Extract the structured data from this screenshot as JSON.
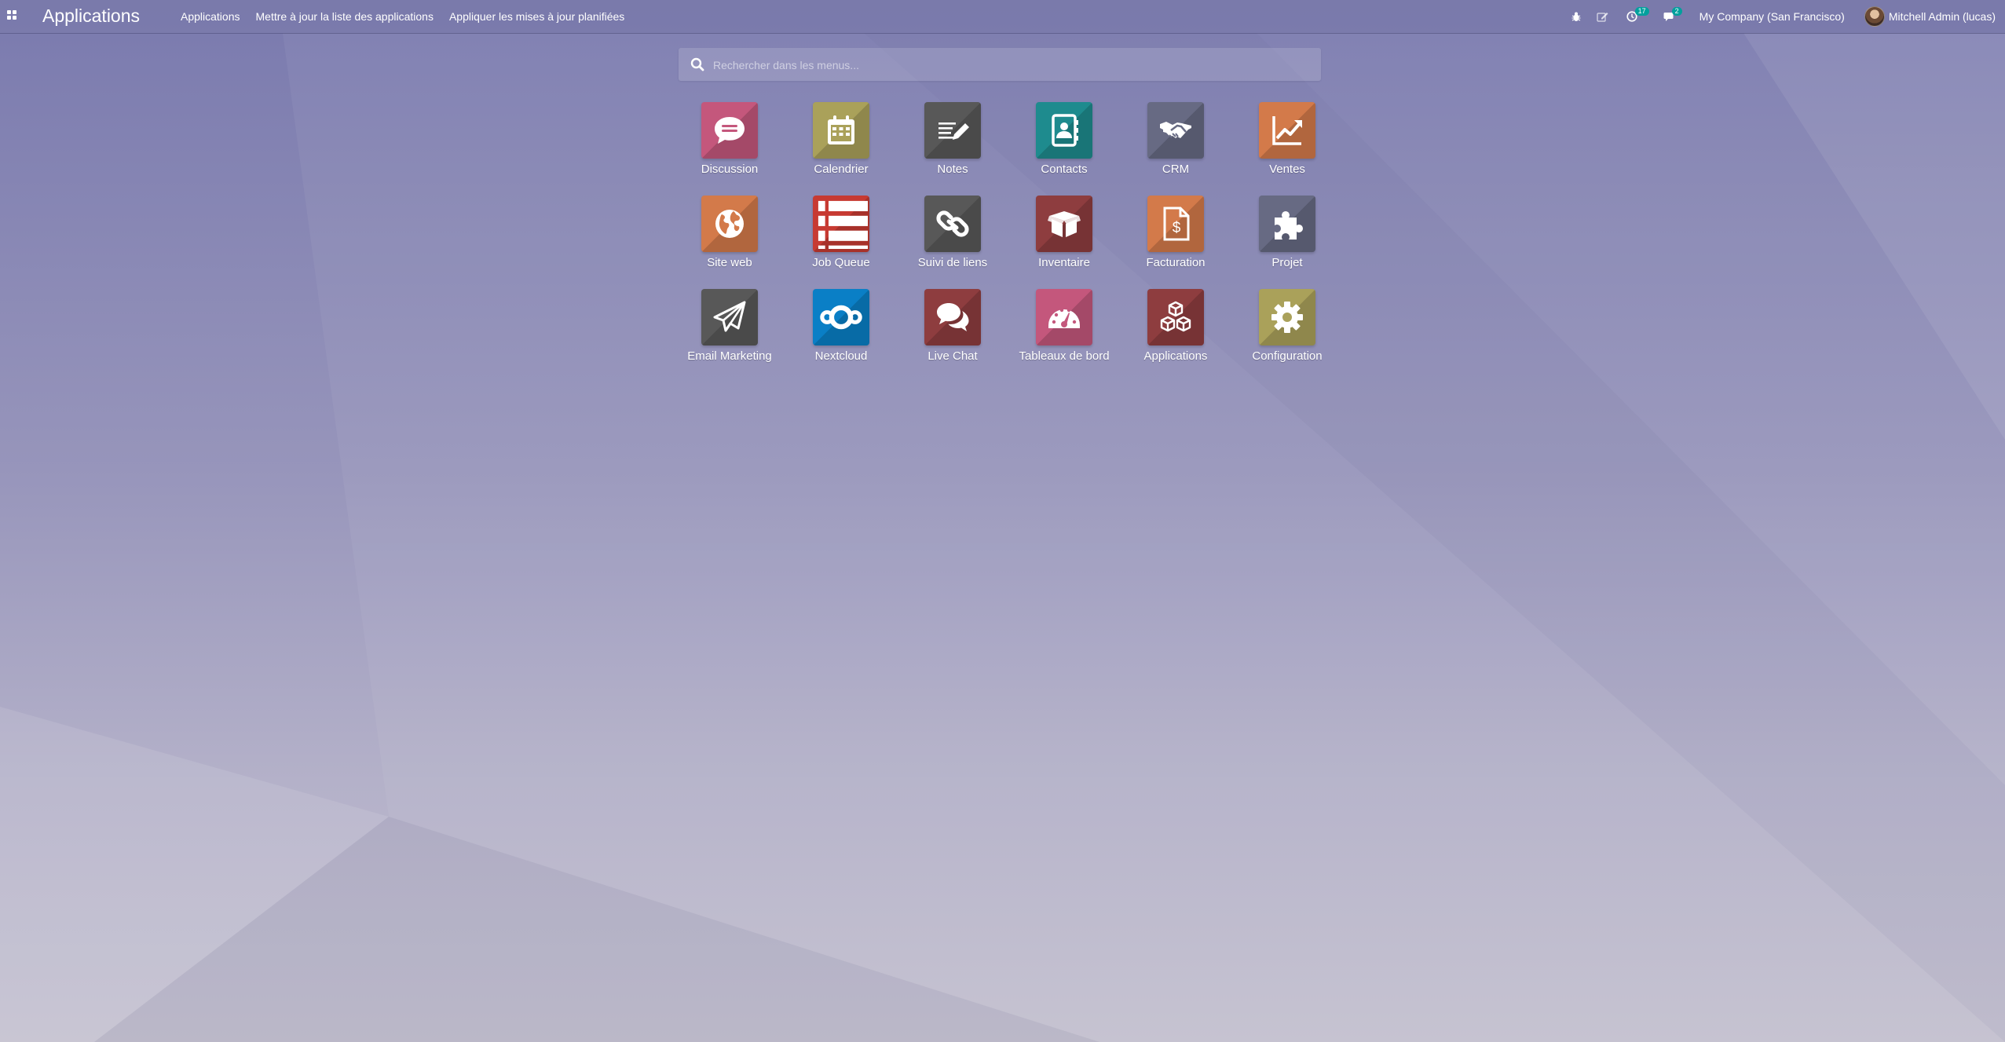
{
  "topbar": {
    "app_title": "Applications",
    "menu": [
      {
        "label": "Applications"
      },
      {
        "label": "Mettre à jour la liste des applications"
      },
      {
        "label": "Appliquer les mises à jour planifiées"
      }
    ],
    "activity_count": "17",
    "message_count": "2",
    "company": "My Company (San Francisco)",
    "user": "Mitchell Admin (lucas)"
  },
  "search": {
    "placeholder": "Rechercher dans les menus..."
  },
  "apps": [
    {
      "label": "Discussion",
      "icon": "chat-bubble-icon",
      "color": "#c4577c"
    },
    {
      "label": "Calendrier",
      "icon": "calendar-icon",
      "color": "#aaa15a"
    },
    {
      "label": "Notes",
      "icon": "notes-pencil-icon",
      "color": "#585858"
    },
    {
      "label": "Contacts",
      "icon": "address-book-icon",
      "color": "#1e8b8e"
    },
    {
      "label": "CRM",
      "icon": "handshake-icon",
      "color": "#676a83"
    },
    {
      "label": "Ventes",
      "icon": "line-chart-icon",
      "color": "#d37a4a"
    },
    {
      "label": "Site web",
      "icon": "globe-icon",
      "color": "#d37a4a"
    },
    {
      "label": "Job Queue",
      "icon": "list-icon",
      "color": "#c73a32"
    },
    {
      "label": "Suivi de liens",
      "icon": "link-icon",
      "color": "#585858"
    },
    {
      "label": "Inventaire",
      "icon": "box-icon",
      "color": "#8e3d3f"
    },
    {
      "label": "Facturation",
      "icon": "invoice-dollar-icon",
      "color": "#d37a4a"
    },
    {
      "label": "Projet",
      "icon": "puzzle-icon",
      "color": "#676a83"
    },
    {
      "label": "Email Marketing",
      "icon": "paper-plane-icon",
      "color": "#585858"
    },
    {
      "label": "Nextcloud",
      "icon": "nextcloud-icon",
      "color": "#0a7fc6"
    },
    {
      "label": "Live Chat",
      "icon": "chat-bubbles-icon",
      "color": "#8e3d3f"
    },
    {
      "label": "Tableaux de bord",
      "icon": "gauge-icon",
      "color": "#c4577c"
    },
    {
      "label": "Applications",
      "icon": "cubes-icon",
      "color": "#8e3d3f"
    },
    {
      "label": "Configuration",
      "icon": "gear-icon",
      "color": "#aaa15a"
    }
  ]
}
